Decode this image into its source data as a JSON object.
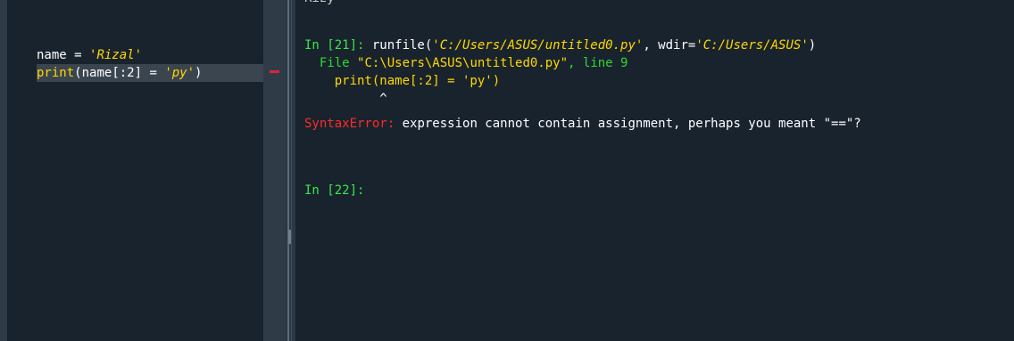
{
  "editor": {
    "line1": {
      "var": "name",
      "op": " = ",
      "str": "'Rizal'"
    },
    "line2": {
      "fn": "print",
      "open": "(",
      "var": "name",
      "slice": "[:2]",
      "op": " = ",
      "str": "'py'",
      "close": ")"
    }
  },
  "console": {
    "top_cut": "Rizy",
    "prompt1": "In [21]: ",
    "cmd_fn": "runfile(",
    "cmd_arg1": "'C:/Users/ASUS/untitled0.py'",
    "cmd_sep": ", wdir=",
    "cmd_arg2": "'C:/Users/ASUS'",
    "cmd_close": ")",
    "tb_file_label": "  File ",
    "tb_file_path": "\"C:\\Users\\ASUS\\untitled0.py\"",
    "tb_line": ", line 9",
    "tb_code": "    print(name[:2] = 'py')",
    "tb_caret": "          ^",
    "error_type": "SyntaxError:",
    "error_msg": " expression cannot contain assignment, perhaps you meant \"==\"?",
    "prompt2": "In [22]:"
  },
  "colors": {
    "background": "#19232d",
    "prompt": "#37e84a",
    "string": "#ffd700",
    "error": "#ff2a2a",
    "warning_marker": "#e0213a"
  }
}
